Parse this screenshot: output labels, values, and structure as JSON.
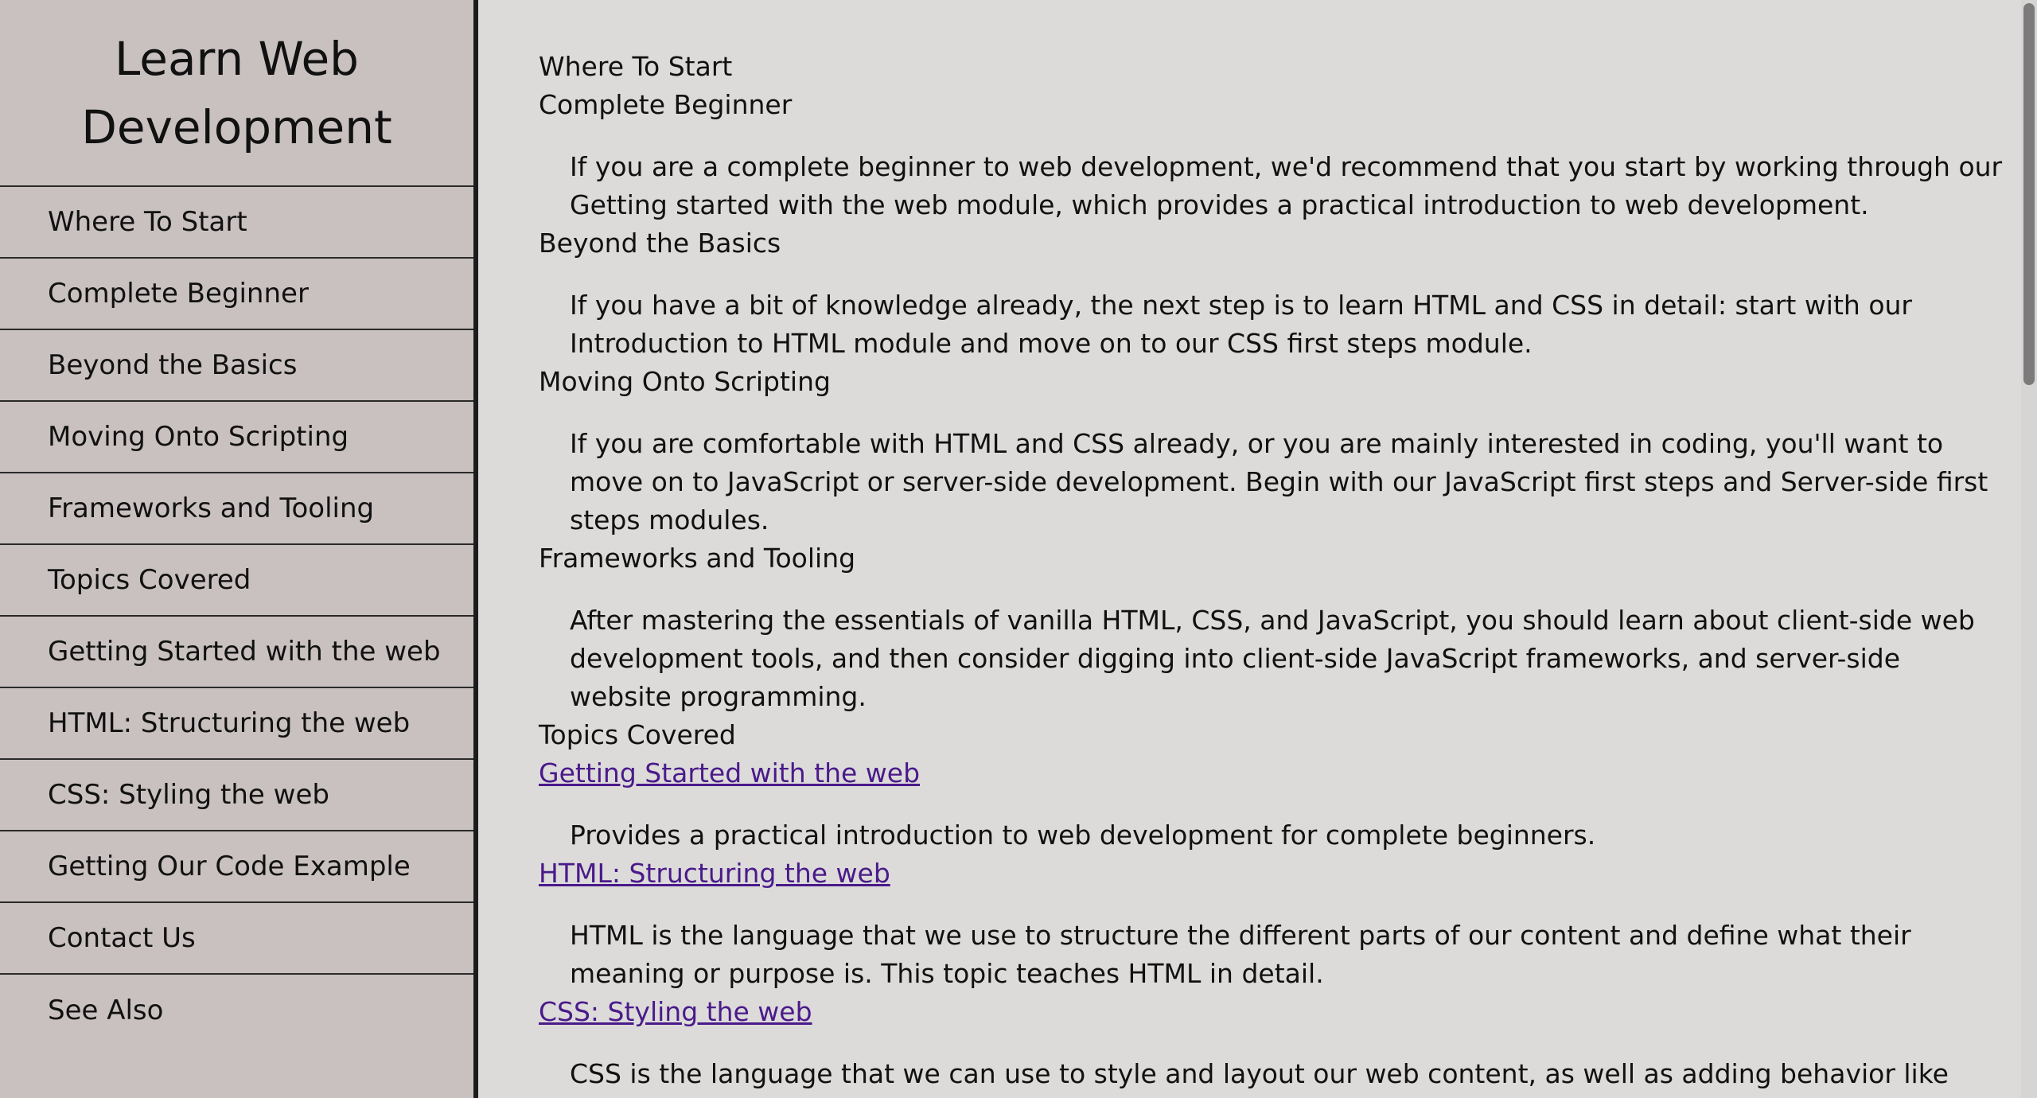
{
  "sidebar": {
    "title": "Learn Web Development",
    "items": [
      {
        "label": "Where To Start"
      },
      {
        "label": "Complete Beginner"
      },
      {
        "label": "Beyond the Basics"
      },
      {
        "label": "Moving Onto Scripting"
      },
      {
        "label": "Frameworks and Tooling"
      },
      {
        "label": "Topics Covered"
      },
      {
        "label": "Getting Started with the web"
      },
      {
        "label": "HTML: Structuring the web"
      },
      {
        "label": "CSS: Styling the web"
      },
      {
        "label": "Getting Our Code Example"
      },
      {
        "label": "Contact Us"
      },
      {
        "label": "See Also"
      }
    ]
  },
  "main": {
    "where_to_start": "Where To Start",
    "complete_beginner": {
      "heading": "Complete Beginner",
      "text": "If you are a complete beginner to web development, we'd recommend that you start by working through our Getting started with the web module, which provides a practical introduction to web development."
    },
    "beyond_basics": {
      "heading": "Beyond the Basics",
      "text": "If you have a bit of knowledge already, the next step is to learn HTML and CSS in detail: start with our Introduction to HTML module and move on to our CSS first steps module."
    },
    "moving_scripting": {
      "heading": "Moving Onto Scripting",
      "text": "If you are comfortable with HTML and CSS already, or you are mainly interested in coding, you'll want to move on to JavaScript or server-side development. Begin with our JavaScript first steps and Server-side first steps modules."
    },
    "frameworks": {
      "heading": "Frameworks and Tooling",
      "text": "After mastering the essentials of vanilla HTML, CSS, and JavaScript, you should learn about client-side web development tools, and then consider digging into client-side JavaScript frameworks, and server-side website programming."
    },
    "topics": {
      "heading": "Topics Covered",
      "items": [
        {
          "link": "Getting Started with the web",
          "text": "Provides a practical introduction to web development for complete beginners."
        },
        {
          "link": "HTML: Structuring the web",
          "text": "HTML is the language that we use to structure the different parts of our content and define what their meaning or purpose is. This topic teaches HTML in detail."
        },
        {
          "link": "CSS: Styling the web",
          "text": "CSS is the language that we can use to style and layout our web content, as well as adding behavior like"
        }
      ]
    }
  },
  "colors": {
    "sidebar_bg": "#c9c1c0",
    "content_bg": "#dcdbda",
    "link": "#4a1a8a"
  }
}
